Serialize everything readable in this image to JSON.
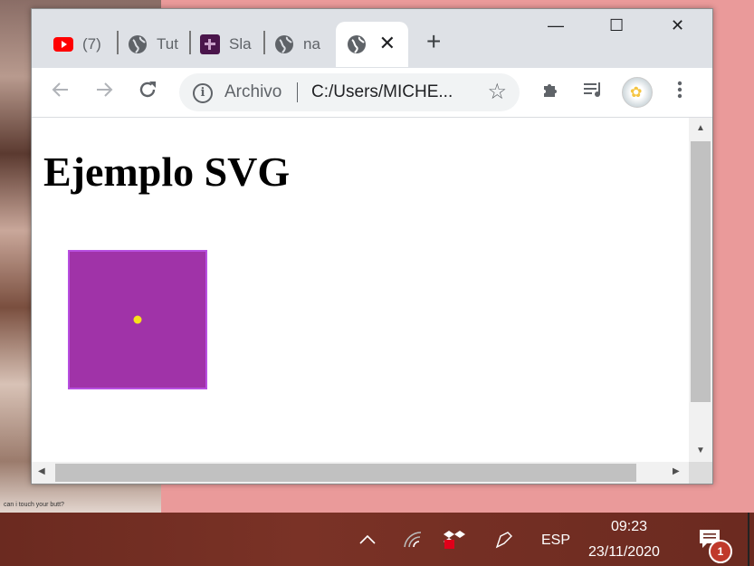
{
  "browser": {
    "tabs": [
      {
        "icon": "youtube-icon",
        "title": "(7)"
      },
      {
        "icon": "globe-icon",
        "title": "Tut"
      },
      {
        "icon": "slack-icon",
        "title": "Sla"
      },
      {
        "icon": "globe-icon",
        "title": "na"
      },
      {
        "icon": "globe-icon",
        "title": "",
        "active": true
      }
    ],
    "new_tab_glyph": "+",
    "window_controls": {
      "minimize": "—",
      "maximize": "☐",
      "close": "✕"
    },
    "omnibox": {
      "label": "Archivo",
      "url": "C:/Users/MICHE..."
    },
    "colors": {
      "tabstrip": "#dee1e6",
      "toolbar": "#ffffff"
    }
  },
  "page": {
    "title": "Ejemplo SVG",
    "svg": {
      "rect_fill": "#a033a8",
      "rect_stroke": "#b84fe0",
      "dot_fill": "#f7e21b"
    }
  },
  "taskbar": {
    "language": "ESP",
    "time": "09:23",
    "date": "23/11/2020",
    "notification_count": "1"
  },
  "desktop": {
    "poster_caption": "can i touch your butt?"
  }
}
